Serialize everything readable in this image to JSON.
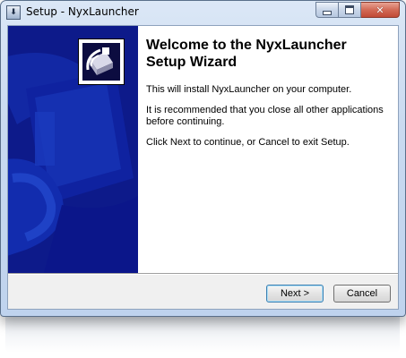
{
  "window": {
    "title": "Setup - NyxLauncher",
    "icon": "setup-app-icon",
    "controls": {
      "minimize": "minimize-icon",
      "maximize": "maximize-icon",
      "close": "close-icon"
    }
  },
  "wizard": {
    "heading": "Welcome to the NyxLauncher Setup Wizard",
    "paragraphs": [
      "This will install NyxLauncher on your computer.",
      "It is recommended that you close all other applications before continuing.",
      "Click Next to continue, or Cancel to exit Setup."
    ],
    "colors": {
      "side_panel": "#0d1a8a",
      "content_bg": "#ffffff",
      "chrome": "#f0f0f0"
    }
  },
  "buttons": {
    "next": "Next >",
    "cancel": "Cancel"
  }
}
